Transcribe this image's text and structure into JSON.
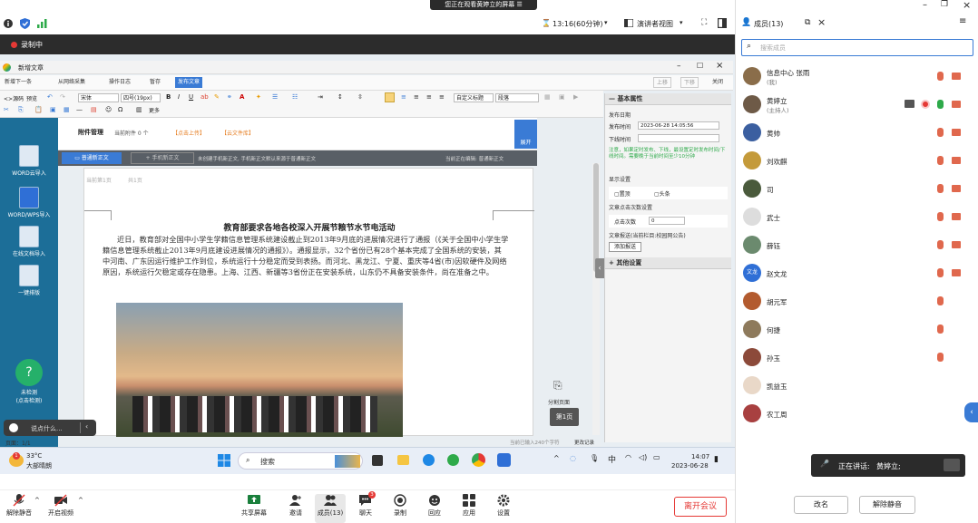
{
  "banner": {
    "text": "您正在观看黄婷立的屏幕",
    "icon": "screen-menu-icon"
  },
  "topbar": {
    "timer": "13:16(60分钟)",
    "view_mode": "演讲者视图",
    "icons": [
      "info-icon",
      "shield-icon",
      "signal-icon",
      "hourglass-icon",
      "view-icon",
      "fullscreen-icon",
      "layout-icon"
    ]
  },
  "recording": {
    "label": "录制中",
    "color": "#e53935"
  },
  "doc_window": {
    "title": "新增文章",
    "toolbar_buttons": [
      "新增下一条",
      "从网络采集",
      "操作日志",
      "暂存",
      "发布文章"
    ],
    "right_buttons": [
      "上移",
      "下移",
      "关闭"
    ],
    "format_row1": {
      "source_label": "源码",
      "preview_label": "预览",
      "font": "宋体",
      "size": "四号(19px)",
      "heading": "自定义标题",
      "paragraph": "段落"
    },
    "format_row2": {
      "more_label": "更多"
    },
    "attachment_label": "附件管理",
    "attachment_value": "当前附件 0 个",
    "upload_link": "【点击上传】",
    "cloud_link": "【云文件库】",
    "expand_label": "展开",
    "editor_buttons": {
      "normal": "普通新正文",
      "mobile": "手机新正文"
    },
    "editor_hint": "未创建手机新正文, 手机新正文默认来源于普通新正文",
    "editing_status": "当前正在编辑: 普通新正文",
    "page_info": {
      "current": "当前第1页",
      "total": "共1页"
    },
    "article_title": "教育部要求各地各校深入开展节粮节水节电活动",
    "article_body": "近日，教育部对全国中小学生学籍信息管理系统建设截止到2013年9月底的进展情况进行了通报（《关于全国中小学生学籍信息管理系统截止2013年9月底建设进展情况的通报》）。通报显示，32个省份已有28个基本完成了全国系统的安装，其中河南、广东因运行维护工作到位，系统运行十分稳定而受到表扬。而河北、黑龙江、宁夏、重庆等4省(市)因软硬件及网络原因，系统运行欠稳定或存在隐患。上海、江西、新疆等3省份正在安装系统，山东仍不具备安装条件，尚在准备之中。",
    "split_page_label": "分割页面",
    "page_button": "第1页",
    "status_bar_left": "页面：1/1",
    "status_bar_right": "当前已输入240个字符",
    "status_bar_link": "更改记录"
  },
  "left_panel": {
    "items": [
      "WORD云导入",
      "WORD/WPS导入",
      "在线文档导入",
      "一键排版"
    ],
    "security_label": "未检测",
    "security_sub": "(点击检测)"
  },
  "right_props": {
    "basic_heading": "基本属性",
    "publish_date_label": "发布日期",
    "publish_time_label": "发布时间",
    "publish_time_value": "2023-06-28 14:05:56",
    "offline_time_label": "下线时间",
    "notice": "注意，如果定时发布、下线，最设置定时发布时间/下线时间。需要晚于当前时间至少10分钟",
    "display_label": "显示设置",
    "pin_label": "置顶",
    "headline_label": "头条",
    "clicks_label": "文章点击次数设置",
    "clicks_field_label": "点击次数",
    "clicks_value": "0",
    "push_label": "文章报送(当前栏目:校园网公告)",
    "add_push_button": "添加报送",
    "other_heading": "其他设置"
  },
  "chat_prompt": "说点什么...",
  "taskbar": {
    "weather_temp": "33°C",
    "weather_desc": "大部晴朗",
    "search_placeholder": "搜索",
    "ime": "中",
    "time": "14:07",
    "date": "2023-06-28"
  },
  "bottom_controls": {
    "left": [
      {
        "label": "解除静音",
        "icon": "mic-muted-icon"
      },
      {
        "label": "开启视频",
        "icon": "video-off-icon"
      }
    ],
    "center": [
      {
        "label": "共享屏幕",
        "icon": "share-screen-icon"
      },
      {
        "label": "邀请",
        "icon": "invite-icon"
      },
      {
        "label": "成员(13)",
        "icon": "members-icon"
      },
      {
        "label": "聊天",
        "icon": "chat-icon"
      },
      {
        "label": "录制",
        "icon": "record-icon"
      },
      {
        "label": "回应",
        "icon": "reaction-icon"
      },
      {
        "label": "应用",
        "icon": "apps-icon"
      },
      {
        "label": "设置",
        "icon": "settings-icon"
      }
    ],
    "chat_badge": "3",
    "leave_label": "离开会议",
    "leave_color": "#e53935"
  },
  "members_panel": {
    "title": "成员(13)",
    "search_placeholder": "搜索成员",
    "members": [
      {
        "name": "信息中心 张雨",
        "sub": "(我)",
        "mic": "muted",
        "cam": "off",
        "avatar_color": "#8a6d4a"
      },
      {
        "name": "黄婷立",
        "sub": "(主持人)",
        "mic": "on",
        "cam": "off",
        "avatar_color": "#6e5a47",
        "sharing": true,
        "recording": true
      },
      {
        "name": "黄帅",
        "sub": "",
        "mic": "muted",
        "cam": "off",
        "avatar_color": "#3b5fa0"
      },
      {
        "name": "刘欢麒",
        "sub": "",
        "mic": "muted",
        "cam": "off",
        "avatar_color": "#c49a3a"
      },
      {
        "name": "司",
        "sub": "",
        "mic": "muted",
        "cam": "off",
        "avatar_color": "#4a5a3c"
      },
      {
        "name": "武士",
        "sub": "",
        "mic": "muted",
        "cam": "off",
        "avatar_color": "#dddddd"
      },
      {
        "name": "薛钰",
        "sub": "",
        "mic": "muted",
        "cam": "off",
        "avatar_color": "#6b8a6e"
      },
      {
        "name": "赵文龙",
        "sub": "",
        "mic": "muted",
        "cam": "off",
        "avatar_color": "#2f6fd6",
        "avatar_text": "文龙"
      },
      {
        "name": "胡元军",
        "sub": "",
        "mic": "muted",
        "cam": "none",
        "avatar_color": "#b35b2f"
      },
      {
        "name": "何捷",
        "sub": "",
        "mic": "muted",
        "cam": "none",
        "avatar_color": "#8e7a5c"
      },
      {
        "name": "孙玉",
        "sub": "",
        "mic": "muted",
        "cam": "none",
        "avatar_color": "#8c4a3a"
      },
      {
        "name": "凯益玉",
        "sub": "",
        "mic": "none",
        "cam": "none",
        "avatar_color": "#e9d8c8"
      },
      {
        "name": "农工周",
        "sub": "",
        "mic": "none",
        "cam": "none",
        "avatar_color": "#a84040"
      }
    ],
    "speaking_label": "正在讲话:",
    "speaking_name": "黄婷立;",
    "rename_button": "改名",
    "unmute_button": "解除静音"
  }
}
